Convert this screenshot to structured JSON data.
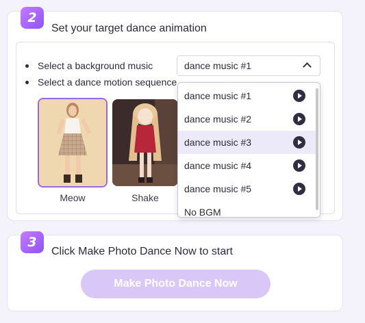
{
  "step2": {
    "badge": "2",
    "title": "Set your target dance animation",
    "music_label": "Select a background music",
    "motion_label": "Select a dance motion sequence",
    "select": {
      "value": "dance music #1",
      "expanded": true
    },
    "dropdown_options": [
      {
        "label": "dance music #1",
        "has_play": true,
        "selected": false
      },
      {
        "label": "dance music #2",
        "has_play": true,
        "selected": false
      },
      {
        "label": "dance music #3",
        "has_play": true,
        "selected": true
      },
      {
        "label": "dance music #4",
        "has_play": true,
        "selected": false
      },
      {
        "label": "dance music #5",
        "has_play": true,
        "selected": false
      },
      {
        "label": "No BGM",
        "has_play": false,
        "selected": false
      }
    ],
    "motions": [
      {
        "label": "Meow",
        "selected": true
      },
      {
        "label": "Shake",
        "selected": false
      }
    ]
  },
  "step3": {
    "badge": "3",
    "title": "Click Make Photo Dance Now to start",
    "button_label": "Make Photo Dance Now"
  },
  "colors": {
    "accent": "#9b66e0",
    "badge_gradient_start": "#c47bff",
    "badge_gradient_end": "#8f54f5",
    "button_disabled": "#d9c8f7",
    "option_selected_bg": "#ece9f8",
    "play_icon": "#2f2e42"
  }
}
